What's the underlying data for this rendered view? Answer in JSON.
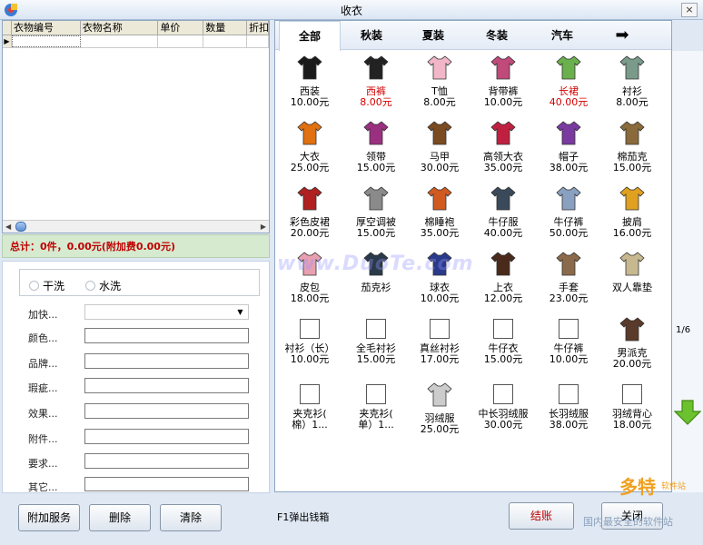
{
  "window": {
    "title": "收衣",
    "close": "×"
  },
  "grid": {
    "columns": [
      "衣物编号",
      "衣物名称",
      "单价",
      "数量",
      "折扣"
    ],
    "row_marker": "▶"
  },
  "total": "总计：0件，0.00元(附加费0.00元)",
  "form": {
    "wash_options": [
      "干洗",
      "水洗"
    ],
    "fields": [
      "加快...",
      "颜色...",
      "品牌...",
      "瑕疵...",
      "效果...",
      "附件...",
      "要求...",
      "其它..."
    ]
  },
  "buttons": {
    "extra_service": "附加服务",
    "delete": "删除",
    "clear": "清除",
    "hint": "F1弹出钱箱",
    "checkout": "结账",
    "close": "关闭"
  },
  "tabs": [
    "全部",
    "秋装",
    "夏装",
    "冬装",
    "汽车"
  ],
  "tab_arrow": "➡",
  "page_indicator": "1/6",
  "items": [
    {
      "name": "西装",
      "price": "10.00元",
      "red": false,
      "icon": "suit-icon",
      "color": "#1a1a1a"
    },
    {
      "name": "西裤",
      "price": "8.00元",
      "red": true,
      "icon": "trousers-icon",
      "color": "#222222"
    },
    {
      "name": "T恤",
      "price": "8.00元",
      "red": false,
      "icon": "tshirt-icon",
      "color": "#f2b6c8"
    },
    {
      "name": "背带裤",
      "price": "10.00元",
      "red": false,
      "icon": "overalls-icon",
      "color": "#c04a7a"
    },
    {
      "name": "长裙",
      "price": "40.00元",
      "red": true,
      "icon": "dress-icon",
      "color": "#6ab04c"
    },
    {
      "name": "衬衫",
      "price": "8.00元",
      "red": false,
      "icon": "shirt-icon",
      "color": "#7a9a8a"
    },
    {
      "name": "大衣",
      "price": "25.00元",
      "red": false,
      "icon": "coat-icon",
      "color": "#e07010"
    },
    {
      "name": "领带",
      "price": "15.00元",
      "red": false,
      "icon": "tie-icon",
      "color": "#9c3080"
    },
    {
      "name": "马甲",
      "price": "30.00元",
      "red": false,
      "icon": "vest-icon",
      "color": "#7a4a20"
    },
    {
      "name": "高领大衣",
      "price": "35.00元",
      "red": false,
      "icon": "long-coat-icon",
      "color": "#c02040"
    },
    {
      "name": "帽子",
      "price": "38.00元",
      "red": false,
      "icon": "hat-icon",
      "color": "#7a3aa0"
    },
    {
      "name": "棉茄克",
      "price": "15.00元",
      "red": false,
      "icon": "padded-jacket-icon",
      "color": "#8a6a3a"
    },
    {
      "name": "彩色皮裙",
      "price": "20.00元",
      "red": false,
      "icon": "leather-skirt-icon",
      "color": "#b02020"
    },
    {
      "name": "厚空调被",
      "price": "15.00元",
      "red": false,
      "icon": "quilt-icon",
      "color": "#8a8a8a"
    },
    {
      "name": "棉睡袍",
      "price": "35.00元",
      "red": false,
      "icon": "robe-icon",
      "color": "#d05a20"
    },
    {
      "name": "牛仔服",
      "price": "40.00元",
      "red": false,
      "icon": "denim-jacket-icon",
      "color": "#3a4a5a"
    },
    {
      "name": "牛仔裤",
      "price": "50.00元",
      "red": false,
      "icon": "jeans-icon",
      "color": "#8aa0c0"
    },
    {
      "name": "披肩",
      "price": "16.00元",
      "red": false,
      "icon": "shawl-icon",
      "color": "#e0a020"
    },
    {
      "name": "皮包",
      "price": "18.00元",
      "red": false,
      "icon": "handbag-icon",
      "color": "#e8a0b0"
    },
    {
      "name": "茄克衫",
      "price": "",
      "red": false,
      "icon": "jacket-icon",
      "color": "#2a3a4a"
    },
    {
      "name": "球衣",
      "price": "10.00元",
      "red": false,
      "icon": "jersey-icon",
      "color": "#2a3a8a"
    },
    {
      "name": "上衣",
      "price": "12.00元",
      "red": false,
      "icon": "top-icon",
      "color": "#4a2a1a"
    },
    {
      "name": "手套",
      "price": "23.00元",
      "red": false,
      "icon": "gloves-icon",
      "color": "#8a6a4a"
    },
    {
      "name": "双人靠垫",
      "price": "",
      "red": false,
      "icon": "cushion-icon",
      "color": "#c8b890"
    },
    {
      "name": "衬衫（长）",
      "price": "10.00元",
      "red": false,
      "icon": "",
      "color": ""
    },
    {
      "name": "全毛衬衫",
      "price": "15.00元",
      "red": false,
      "icon": "",
      "color": ""
    },
    {
      "name": "真丝衬衫",
      "price": "17.00元",
      "red": false,
      "icon": "",
      "color": ""
    },
    {
      "name": "牛仔衣",
      "price": "15.00元",
      "red": false,
      "icon": "",
      "color": ""
    },
    {
      "name": "牛仔裤",
      "price": "10.00元",
      "red": false,
      "icon": "",
      "color": ""
    },
    {
      "name": "男派克",
      "price": "20.00元",
      "red": false,
      "icon": "parka-icon",
      "color": "#5a3a2a"
    },
    {
      "name": "夹克衫(",
      "sub": "棉）1...",
      "price": "",
      "red": false,
      "icon": "",
      "color": ""
    },
    {
      "name": "夹克衫(",
      "sub": "单）1...",
      "price": "",
      "red": false,
      "icon": "",
      "color": ""
    },
    {
      "name": "羽绒服",
      "price": "25.00元",
      "red": false,
      "icon": "down-jacket-icon",
      "color": "#cccccc"
    },
    {
      "name": "中长羽绒服",
      "price": "30.00元",
      "red": false,
      "icon": "",
      "color": ""
    },
    {
      "name": "长羽绒服",
      "price": "38.00元",
      "red": false,
      "icon": "",
      "color": ""
    },
    {
      "name": "羽绒背心",
      "price": "18.00元",
      "red": false,
      "icon": "",
      "color": ""
    }
  ],
  "watermark": "www.DuoTe.com",
  "corner_logo": {
    "big": "多特",
    "small": "软件站",
    "tag": "国内最安全的软件站"
  }
}
